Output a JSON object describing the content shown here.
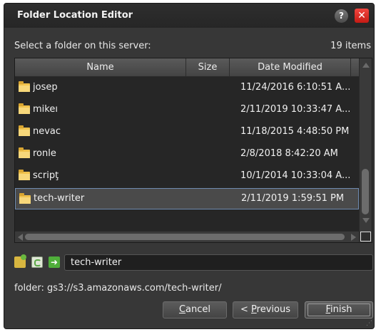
{
  "window": {
    "title": "Folder Location Editor",
    "help_label": "?",
    "close_label": "✕"
  },
  "prompt": "Select a folder on this server:",
  "item_count": "19 items",
  "columns": {
    "name": "Name",
    "size": "Size",
    "date": "Date Modified"
  },
  "rows": [
    {
      "name": "josep",
      "size": "",
      "date": "11/24/2016 6:10:51 A..."
    },
    {
      "name": "mikeı",
      "size": "",
      "date": "2/11/2019 10:33:47 A..."
    },
    {
      "name": "nevac",
      "size": "",
      "date": "11/18/2015 4:48:50 PM"
    },
    {
      "name": "ronle",
      "size": "",
      "date": "2/8/2018 8:42:20 AM"
    },
    {
      "name": "scripţ",
      "size": "",
      "date": "10/1/2014 10:33:04 A..."
    },
    {
      "name": "tech-writer",
      "size": "",
      "date": "2/11/2019 1:59:51 PM",
      "selected": true
    }
  ],
  "path_input": {
    "value": "tech-writer"
  },
  "folder_path": "folder: gs3://s3.amazonaws.com/tech-writer/",
  "buttons": {
    "cancel": {
      "accel": "C",
      "rest": "ancel"
    },
    "previous": {
      "prefix": "< ",
      "accel": "P",
      "rest": "revious"
    },
    "finish": {
      "accel": "F",
      "rest": "inish"
    }
  },
  "icons": {
    "folder": "folder-icon",
    "new_folder": "new-folder-icon",
    "refresh": "refresh-icon",
    "go": "go-arrow-icon"
  },
  "colors": {
    "background": "#373737",
    "selection_border": "#6f8bb0",
    "close": "#d8261f"
  }
}
